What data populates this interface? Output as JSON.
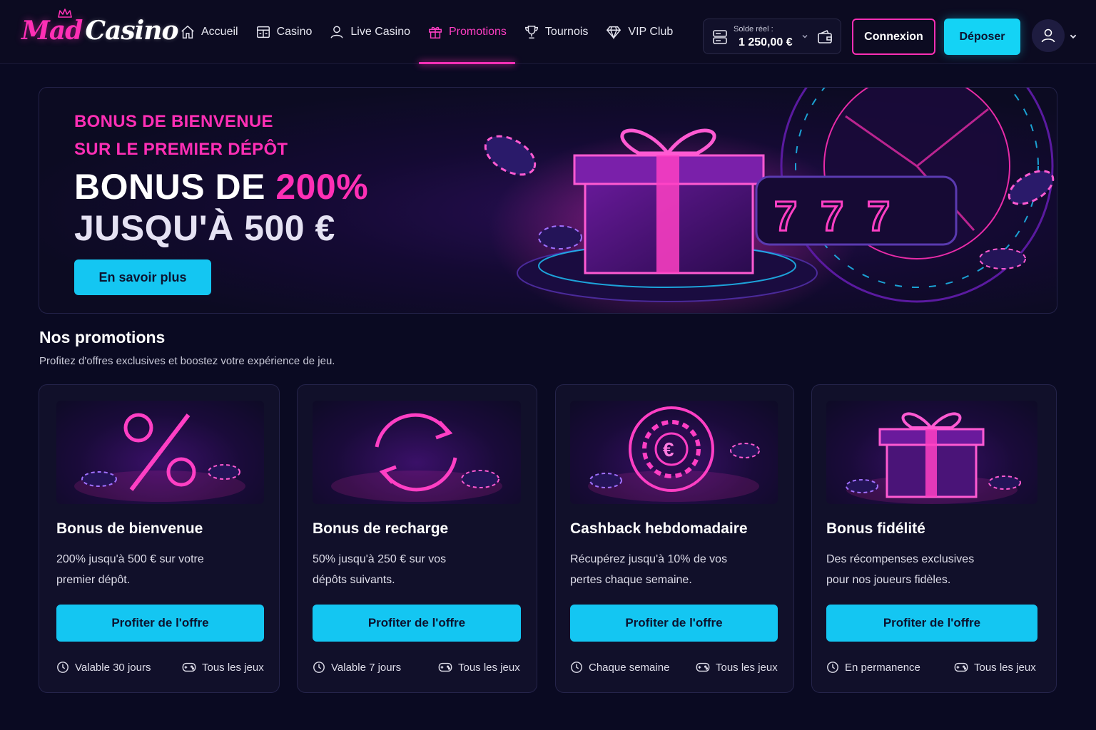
{
  "brand": {
    "logo_part1": "Mad",
    "logo_part2": "Casino",
    "pink": "#ff2fb5",
    "cyan": "#14c6f2"
  },
  "nav": [
    {
      "label": "Accueil",
      "icon": "home-icon"
    },
    {
      "label": "Casino",
      "icon": "casino-icon"
    },
    {
      "label": "Live Casino",
      "icon": "user-icon"
    },
    {
      "label": "Promotions",
      "icon": "gift-icon",
      "active": true
    },
    {
      "label": "Tournois",
      "icon": "trophy-icon"
    },
    {
      "label": "VIP Club",
      "icon": "diamond-icon"
    }
  ],
  "header": {
    "balance_label": "Solde réel :",
    "balance_value": "1 250,00 €",
    "login_label": "Connexion",
    "deposit_label": "Déposer"
  },
  "hero": {
    "subtitle_line1": "BONUS DE BIENVENUE",
    "subtitle_line2": "SUR LE PREMIER DÉPÔT",
    "title_prefix": "BONUS DE ",
    "title_highlight": "200%",
    "title_line2": "JUSQU'À 500 €",
    "cta_label": "En savoir plus"
  },
  "section": {
    "title": "Nos promotions",
    "subtitle": "Profitez d'offres exclusives et boostez votre expérience de jeu."
  },
  "cards": [
    {
      "title": "Bonus de bienvenue",
      "desc_line1": "200% jusqu'à 500 € sur votre",
      "desc_line2": "premier dépôt.",
      "cta": "Profiter de l'offre",
      "validity": "Valable 30 jours",
      "games": "Tous les jeux",
      "image_icon": "percent-icon"
    },
    {
      "title": "Bonus de recharge",
      "desc_line1": "50% jusqu'à 250 € sur vos",
      "desc_line2": "dépôts suivants.",
      "cta": "Profiter de l'offre",
      "validity": "Valable 7 jours",
      "games": "Tous les jeux",
      "image_icon": "refresh-icon"
    },
    {
      "title": "Cashback hebdomadaire",
      "desc_line1": "Récupérez jusqu'à 10% de vos",
      "desc_line2": "pertes chaque semaine.",
      "cta": "Profiter de l'offre",
      "validity": "Chaque semaine",
      "games": "Tous les jeux",
      "image_icon": "euro-chip-icon"
    },
    {
      "title": "Bonus fidélité",
      "desc_line1": "Des récompenses exclusives",
      "desc_line2": "pour nos joueurs fidèles.",
      "cta": "Profiter de l'offre",
      "validity": "En permanence",
      "games": "Tous les jeux",
      "image_icon": "gift-icon"
    }
  ]
}
